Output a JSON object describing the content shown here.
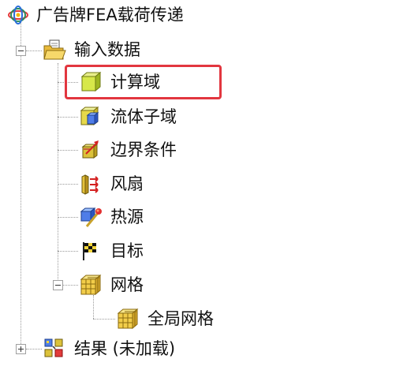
{
  "tree": {
    "root": {
      "label": "广告牌FEA载荷传递",
      "icon": "analysis-tree-icon"
    },
    "input": {
      "label": "输入数据",
      "icon": "open-folder-icon",
      "expanded": true
    },
    "items": [
      {
        "id": "compute-domain",
        "label": "计算域",
        "icon": "compute-domain-icon",
        "selected": true
      },
      {
        "id": "fluid-subdomain",
        "label": "流体子域",
        "icon": "fluid-subdomain-icon"
      },
      {
        "id": "boundary-conditions",
        "label": "边界条件",
        "icon": "boundary-conditions-icon"
      },
      {
        "id": "fan",
        "label": "风扇",
        "icon": "fan-icon"
      },
      {
        "id": "heat-source",
        "label": "热源",
        "icon": "heat-source-icon"
      },
      {
        "id": "goals",
        "label": "目标",
        "icon": "goal-flag-icon"
      },
      {
        "id": "mesh",
        "label": "网格",
        "icon": "mesh-icon",
        "expanded": true
      }
    ],
    "mesh_children": [
      {
        "id": "global-mesh",
        "label": "全局网格",
        "icon": "global-mesh-icon"
      }
    ],
    "results": {
      "label": "结果 (未加载)",
      "icon": "results-icon",
      "expanded": false
    }
  },
  "colors": {
    "selection_border": "#e2363f",
    "tree_line": "#9a9a9a",
    "text": "#111111"
  }
}
